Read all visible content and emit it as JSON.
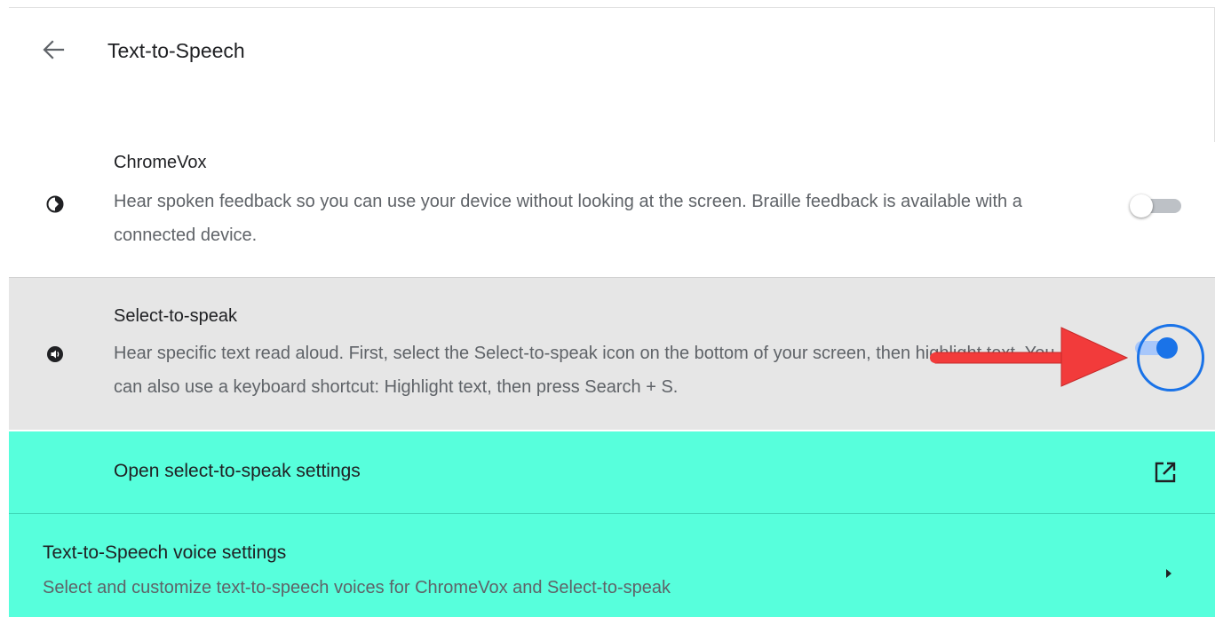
{
  "header": {
    "title": "Text-to-Speech",
    "back_icon": "arrow-left-icon"
  },
  "chromevox": {
    "title": "ChromeVox",
    "description": "Hear spoken feedback so you can use your device without looking at the screen. Braille feedback is available with a connected device.",
    "icon": "chromevox-icon",
    "enabled": false
  },
  "select_to_speak": {
    "title": "Select-to-speak",
    "description": "Hear specific text read aloud. First, select the Select-to-speak icon on the bottom of your screen, then highlight text. You can also use a keyboard shortcut: Highlight text, then press Search + S.",
    "icon": "select-to-speak-icon",
    "enabled": true
  },
  "open_settings": {
    "label": "Open select-to-speak settings",
    "icon": "external-link-icon"
  },
  "voice_settings": {
    "label": "Text-to-Speech voice settings",
    "description": "Select and customize text-to-speech voices for ChromeVox and Select-to-speak",
    "icon": "caret-right-icon"
  },
  "colors": {
    "highlight": "#57ffdc",
    "accent": "#1a73e8",
    "annotation_arrow": "#f23b3b"
  }
}
